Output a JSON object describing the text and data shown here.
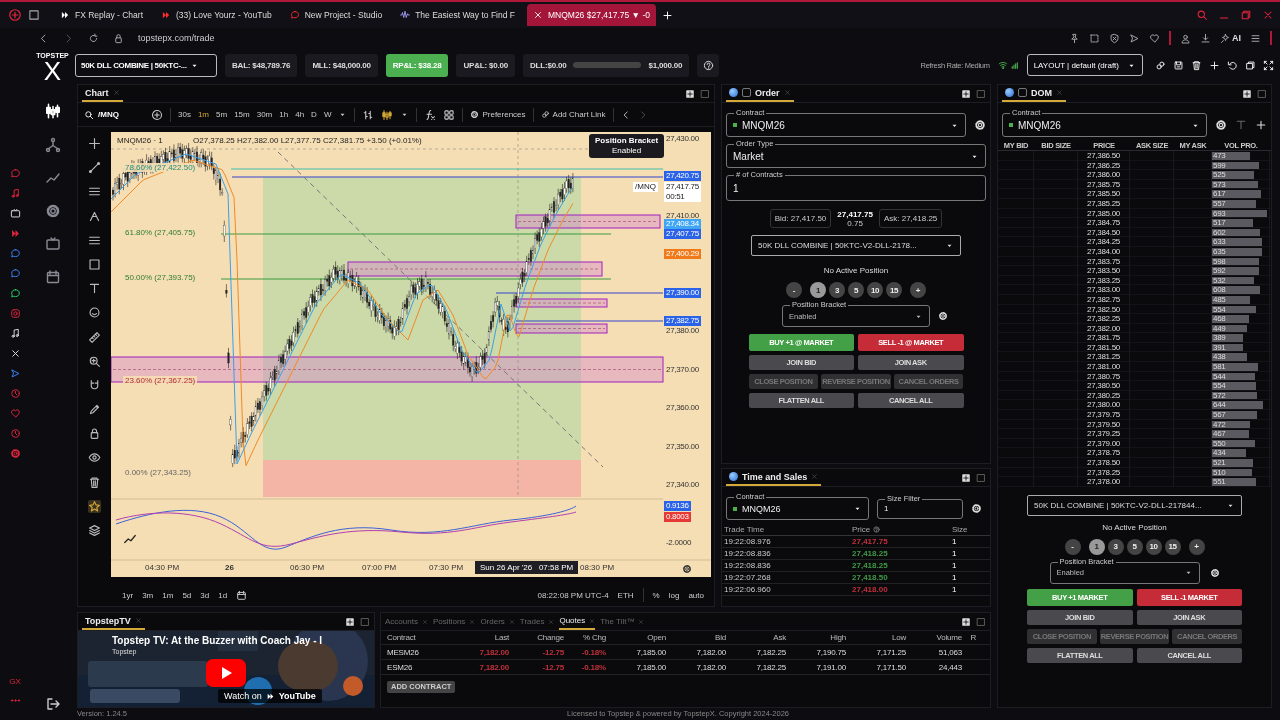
{
  "browser": {
    "tabs": [
      {
        "title": "FX Replay - Chart",
        "kind": "play",
        "selected": false
      },
      {
        "title": "(33) Love Yourz - YouTub",
        "kind": "video",
        "selected": false
      },
      {
        "title": "New Project - Studio",
        "kind": "studio",
        "selected": false
      },
      {
        "title": "The Easiest Way to Find F",
        "kind": "wave",
        "selected": false
      },
      {
        "title": "MNQM26 $27,417.75 ▼ -0",
        "kind": "x",
        "selected": true
      }
    ],
    "url": "topstepx.com/trade",
    "ai_label": "AI",
    "sidebar_badge": "GX"
  },
  "brand": {
    "line1": "TOPSTEP",
    "line2": "X"
  },
  "header": {
    "account": "50K DLL COMBINE | 50KTC-...",
    "stats": [
      {
        "label": "BAL: $48,789.76",
        "kind": "plain"
      },
      {
        "label": "MLL: $48,000.00",
        "kind": "plain"
      },
      {
        "label": "RP&L: $38.28",
        "kind": "positive"
      },
      {
        "label": "UP&L: $0.00",
        "kind": "plain"
      },
      {
        "label": "DLL:$0.00",
        "kind": "meter",
        "level": 0,
        "limit": "$1,000.00"
      }
    ],
    "refresh_rate": "Refresh Rate: Medium",
    "layout": "LAYOUT | default (draft)"
  },
  "chart": {
    "tab": "Chart",
    "symbol": "/MNQ",
    "intervals": [
      {
        "label": "30s",
        "selected": false
      },
      {
        "label": "1m",
        "selected": true
      },
      {
        "label": "5m",
        "selected": false
      },
      {
        "label": "15m",
        "selected": false
      },
      {
        "label": "30m",
        "selected": false
      },
      {
        "label": "1h",
        "selected": false
      },
      {
        "label": "4h",
        "selected": false
      },
      {
        "label": "D",
        "selected": false
      },
      {
        "label": "W",
        "selected": false
      }
    ],
    "preferences": "Preferences",
    "add_link": "Add Chart Link",
    "legend_symbol": "MNQM26 · 1",
    "legend_ohlc": "O27,378.25 H27,382.00 L27,377.75 C27,381.75 +3.50 (+0.01%)",
    "tooltip": {
      "title": "Position Bracket",
      "value": "Enabled"
    },
    "price_labels": [
      {
        "text": "27,430.00",
        "kind": "plain"
      },
      {
        "text": "27,420.75",
        "kind": "blue"
      },
      {
        "text": "27,417.75",
        "kind": "last"
      },
      {
        "text": "27,410.00",
        "kind": "plain"
      },
      {
        "text": "27,408.34",
        "kind": "light"
      },
      {
        "text": "27,407.75",
        "kind": "blue"
      },
      {
        "text": "27,400.29",
        "kind": "orange"
      },
      {
        "text": "27,390.00",
        "kind": "blue"
      },
      {
        "text": "27,382.75",
        "kind": "blue"
      },
      {
        "text": "27,380.00",
        "kind": "plain"
      },
      {
        "text": "27,370.00",
        "kind": "plain"
      },
      {
        "text": "27,360.00",
        "kind": "plain"
      },
      {
        "text": "27,350.00",
        "kind": "plain"
      },
      {
        "text": "27,340.00",
        "kind": "plain"
      },
      {
        "text": "0.9136",
        "kind": "blue"
      },
      {
        "text": "0.8003",
        "kind": "red"
      },
      {
        "text": "-2.0000",
        "kind": "plain"
      }
    ],
    "last_symbol": "/MNQ",
    "countdown": "00:51",
    "fib_labels": [
      "78.60% (27,422.50)",
      "61.80% (27,405.75)",
      "50.00% (27,393.75)",
      "23.60% (27,367.25)",
      "0.00% (27,343.25)"
    ],
    "time_labels": [
      "04:30 PM",
      "26",
      "06:30 PM",
      "07:00 PM",
      "07:30 PM",
      "08:30 PM"
    ],
    "crosshair_time": "Sun 26 Apr '26   07:58 PM",
    "ranges": [
      "1yr",
      "3m",
      "1m",
      "5d",
      "3d",
      "1d"
    ],
    "clock": "08:22:08 PM UTC-4",
    "session": "ETH",
    "scale_options": [
      "%",
      "log",
      "auto"
    ]
  },
  "order": {
    "tab": "Order",
    "contract_label": "Contract",
    "contract": "MNQM26",
    "type_label": "Order Type",
    "type": "Market",
    "qty_label": "# of Contracts",
    "qty": "1",
    "bid": "Bid: 27,417.50",
    "last": "27,417.75",
    "spread": "0.75",
    "ask": "Ask: 27,418.25",
    "account": "50K DLL COMBINE | 50KTC-V2-DLL-2178...",
    "position": "No Active Position",
    "chips": [
      {
        "label": "-",
        "kind": "step",
        "selected": false
      },
      {
        "label": "1",
        "kind": "qty",
        "selected": true
      },
      {
        "label": "3",
        "kind": "qty",
        "selected": false
      },
      {
        "label": "5",
        "kind": "qty",
        "selected": false
      },
      {
        "label": "10",
        "kind": "qty",
        "selected": false
      },
      {
        "label": "15",
        "kind": "qty",
        "selected": false
      },
      {
        "label": "+",
        "kind": "step",
        "selected": false
      }
    ],
    "bracket_label": "Position Bracket",
    "bracket": "Enabled",
    "buttons": [
      {
        "label": "BUY +1 @ MARKET",
        "kind": "buy",
        "disabled": false
      },
      {
        "label": "SELL -1 @ MARKET",
        "kind": "sell",
        "disabled": false
      },
      {
        "label": "JOIN BID",
        "kind": "plain",
        "disabled": false
      },
      {
        "label": "JOIN ASK",
        "kind": "plain",
        "disabled": false
      },
      {
        "label": "CLOSE POSITION",
        "kind": "plain",
        "disabled": true
      },
      {
        "label": "REVERSE POSITION",
        "kind": "plain",
        "disabled": true
      },
      {
        "label": "CANCEL ORDERS",
        "kind": "plain",
        "disabled": true
      },
      {
        "label": "FLATTEN ALL",
        "kind": "plain",
        "disabled": false
      },
      {
        "label": "CANCEL ALL",
        "kind": "plain",
        "disabled": false
      }
    ]
  },
  "time_sales": {
    "tab": "Time and Sales",
    "contract_label": "Contract",
    "contract": "MNQM26",
    "size_label": "Size Filter",
    "size": "1",
    "columns": [
      "Trade Time",
      "Price",
      "Size"
    ],
    "rows": [
      {
        "time": "19:22:08.976",
        "price": "27,417.75",
        "size": "1",
        "color": "#c0303a"
      },
      {
        "time": "19:22:08.836",
        "price": "27,418.25",
        "size": "1",
        "color": "#3f9a44"
      },
      {
        "time": "19:22:08.836",
        "price": "27,418.25",
        "size": "1",
        "color": "#3f9a44"
      },
      {
        "time": "19:22:07.268",
        "price": "27,418.50",
        "size": "1",
        "color": "#3f9a44"
      },
      {
        "time": "19:22:06.960",
        "price": "27,418.00",
        "size": "1",
        "color": "#c0303a"
      }
    ]
  },
  "dom": {
    "tab": "DOM",
    "contract_label": "Contract",
    "contract": "MNQM26",
    "columns": [
      "MY BID",
      "BID SIZE",
      "PRICE",
      "ASK SIZE",
      "MY ASK",
      "VOL PRO."
    ],
    "rows": [
      {
        "price": "27,386.50",
        "volume": "473",
        "level": 0.66
      },
      {
        "price": "27,386.25",
        "volume": "599",
        "level": 0.83
      },
      {
        "price": "27,386.00",
        "volume": "525",
        "level": 0.73
      },
      {
        "price": "27,385.75",
        "volume": "573",
        "level": 0.8
      },
      {
        "price": "27,385.50",
        "volume": "617",
        "level": 0.86
      },
      {
        "price": "27,385.25",
        "volume": "557",
        "level": 0.77
      },
      {
        "price": "27,385.00",
        "volume": "693",
        "level": 0.96
      },
      {
        "price": "27,384.75",
        "volume": "517",
        "level": 0.72
      },
      {
        "price": "27,384.50",
        "volume": "602",
        "level": 0.84
      },
      {
        "price": "27,384.25",
        "volume": "633",
        "level": 0.88
      },
      {
        "price": "27,384.00",
        "volume": "635",
        "level": 0.88
      },
      {
        "price": "27,383.75",
        "volume": "598",
        "level": 0.83
      },
      {
        "price": "27,383.50",
        "volume": "592",
        "level": 0.82
      },
      {
        "price": "27,383.25",
        "volume": "532",
        "level": 0.74
      },
      {
        "price": "27,383.00",
        "volume": "608",
        "level": 0.84
      },
      {
        "price": "27,382.75",
        "volume": "485",
        "level": 0.67
      },
      {
        "price": "27,382.50",
        "volume": "554",
        "level": 0.77
      },
      {
        "price": "27,382.25",
        "volume": "468",
        "level": 0.65
      },
      {
        "price": "27,382.00",
        "volume": "449",
        "level": 0.62
      },
      {
        "price": "27,381.75",
        "volume": "389",
        "level": 0.54
      },
      {
        "price": "27,381.50",
        "volume": "391",
        "level": 0.54
      },
      {
        "price": "27,381.25",
        "volume": "438",
        "level": 0.61
      },
      {
        "price": "27,381.00",
        "volume": "581",
        "level": 0.81
      },
      {
        "price": "27,380.75",
        "volume": "544",
        "level": 0.76
      },
      {
        "price": "27,380.50",
        "volume": "554",
        "level": 0.77
      },
      {
        "price": "27,380.25",
        "volume": "572",
        "level": 0.79
      },
      {
        "price": "27,380.00",
        "volume": "644",
        "level": 0.89
      },
      {
        "price": "27,379.75",
        "volume": "567",
        "level": 0.79
      },
      {
        "price": "27,379.50",
        "volume": "472",
        "level": 0.66
      },
      {
        "price": "27,379.25",
        "volume": "467",
        "level": 0.65
      },
      {
        "price": "27,379.00",
        "volume": "550",
        "level": 0.76
      },
      {
        "price": "27,378.75",
        "volume": "434",
        "level": 0.6
      },
      {
        "price": "27,378.50",
        "volume": "521",
        "level": 0.72
      },
      {
        "price": "27,378.25",
        "volume": "510",
        "level": 0.71
      },
      {
        "price": "27,378.00",
        "volume": "551",
        "level": 0.77
      }
    ],
    "account": "50K DLL COMBINE | 50KTC-V2-DLL-217844...",
    "position": "No Active Position",
    "chips": [
      {
        "label": "-",
        "kind": "step",
        "selected": false
      },
      {
        "label": "1",
        "kind": "qty",
        "selected": true
      },
      {
        "label": "3",
        "kind": "qty",
        "selected": false
      },
      {
        "label": "5",
        "kind": "qty",
        "selected": false
      },
      {
        "label": "10",
        "kind": "qty",
        "selected": false
      },
      {
        "label": "15",
        "kind": "qty",
        "selected": false
      },
      {
        "label": "+",
        "kind": "step",
        "selected": false
      }
    ],
    "bracket_label": "Position Bracket",
    "bracket": "Enabled",
    "buttons": [
      {
        "label": "BUY +1 MARKET",
        "kind": "buy",
        "disabled": false
      },
      {
        "label": "SELL -1 MARKET",
        "kind": "sell",
        "disabled": false
      },
      {
        "label": "JOIN BID",
        "kind": "plain",
        "disabled": false
      },
      {
        "label": "JOIN ASK",
        "kind": "plain",
        "disabled": false
      },
      {
        "label": "CLOSE POSITION",
        "kind": "plain",
        "disabled": true
      },
      {
        "label": "REVERSE POSITION",
        "kind": "plain",
        "disabled": true
      },
      {
        "label": "CANCEL ORDERS",
        "kind": "plain",
        "disabled": true
      },
      {
        "label": "FLATTEN ALL",
        "kind": "plain",
        "disabled": false
      },
      {
        "label": "CANCEL ALL",
        "kind": "plain",
        "disabled": false
      }
    ]
  },
  "tv": {
    "tab": "TopstepTV",
    "video_title": "Topstep TV: At the Buzzer with Coach Jay - I",
    "channel": "Topstep",
    "watch_on": "Watch on",
    "watch_brand": "YouTube"
  },
  "quotes": {
    "tabs": [
      {
        "label": "Accounts",
        "selected": false
      },
      {
        "label": "Positions",
        "selected": false
      },
      {
        "label": "Orders",
        "selected": false
      },
      {
        "label": "Trades",
        "selected": false
      },
      {
        "label": "Quotes",
        "selected": true
      },
      {
        "label": "The Tilt™",
        "selected": false
      }
    ],
    "columns": [
      "Contract",
      "Last",
      "Change",
      "% Chg",
      "Open",
      "Bid",
      "Ask",
      "High",
      "Low",
      "Volume",
      "R"
    ],
    "rows": [
      {
        "cells": [
          "MESM26",
          "7,182.00",
          "-12.75",
          "-0.18%",
          "7,185.00",
          "7,182.00",
          "7,182.25",
          "7,190.75",
          "7,171.25",
          "51,063"
        ],
        "color": "#c0303a"
      },
      {
        "cells": [
          "ESM26",
          "7,182.00",
          "-12.75",
          "-0.18%",
          "7,185.00",
          "7,182.00",
          "7,182.25",
          "7,191.00",
          "7,171.50",
          "24,443"
        ],
        "color": "#c0303a"
      }
    ],
    "add": "ADD CONTRACT"
  },
  "footer": {
    "version": "Version: 1.24.5",
    "license": "Licensed to Topstep & powered by TopstepX. Copyright 2024-2026"
  }
}
